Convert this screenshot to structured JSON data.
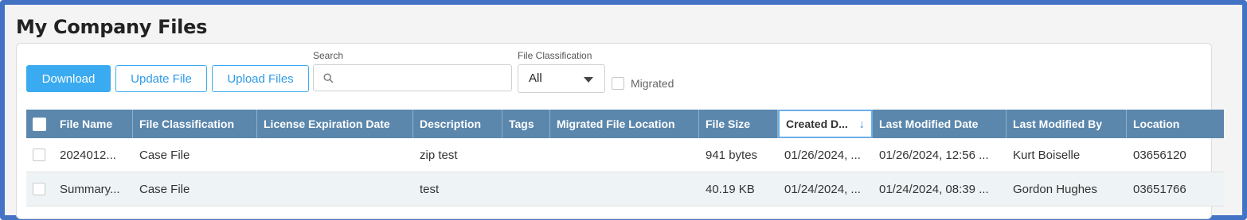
{
  "page": {
    "title": "My Company Files"
  },
  "toolbar": {
    "download_label": "Download",
    "update_label": "Update File",
    "upload_label": "Upload Files",
    "search_label": "Search",
    "search_value": "",
    "classification_label": "File Classification",
    "classification_value": "All",
    "migrated_label": "Migrated"
  },
  "table": {
    "columns": [
      "File Name",
      "File Classification",
      "License Expiration Date",
      "Description",
      "Tags",
      "Migrated File Location",
      "File Size",
      "Created D...",
      "Last Modified Date",
      "Last Modified By",
      "Location"
    ],
    "sorted_column": "Created D...",
    "sort_direction": "descending",
    "rows": [
      {
        "file_name": "2024012...",
        "classification": "Case File",
        "license_expiration": "",
        "description": "zip test",
        "tags": "",
        "migrated_location": "",
        "file_size": "941 bytes",
        "created": "01/26/2024, ...",
        "last_modified": "01/26/2024, 12:56 ...",
        "modified_by": "Kurt Boiselle",
        "location": "03656120"
      },
      {
        "file_name": "Summary...",
        "classification": "Case File",
        "license_expiration": "",
        "description": "test",
        "tags": "",
        "migrated_location": "",
        "file_size": "40.19 KB",
        "created": "01/24/2024, ...",
        "last_modified": "01/24/2024, 08:39 ...",
        "modified_by": "Gordon Hughes",
        "location": "03651766"
      }
    ]
  },
  "colors": {
    "frame": "#4472c4",
    "header": "#5b87ad",
    "primary": "#3aabf0",
    "alt_row": "#eef3f6"
  }
}
